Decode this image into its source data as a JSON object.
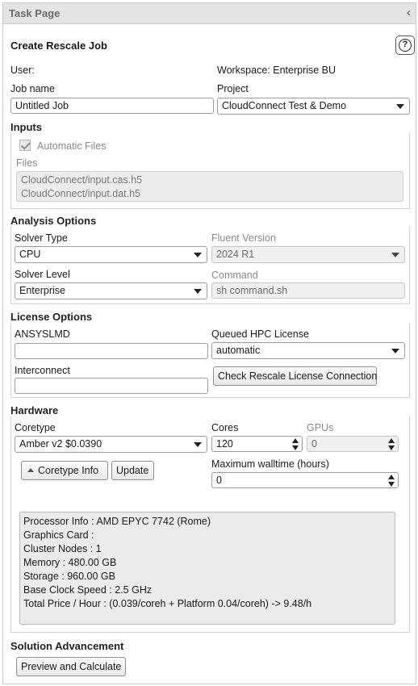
{
  "panel": {
    "title": "Task Page",
    "collapse_glyph": "‹",
    "help_glyph": "?"
  },
  "header": {
    "title": "Create Rescale Job",
    "user_label": "User:",
    "workspace_label": "Workspace: Enterprise BU",
    "job_name_label": "Job name",
    "job_name_value": "Untitled Job",
    "project_label": "Project",
    "project_value": "CloudConnect Test & Demo"
  },
  "inputs": {
    "title": "Inputs",
    "automatic_files_label": "Automatic Files",
    "automatic_files_checked": true,
    "files_label": "Files",
    "files": [
      "CloudConnect/input.cas.h5",
      "CloudConnect/input.dat.h5"
    ]
  },
  "analysis": {
    "title": "Analysis Options",
    "solver_type_label": "Solver Type",
    "solver_type_value": "CPU",
    "fluent_version_label": "Fluent Version",
    "fluent_version_value": "2024 R1",
    "solver_level_label": "Solver Level",
    "solver_level_value": "Enterprise",
    "command_label": "Command",
    "command_value": "sh command.sh"
  },
  "license": {
    "title": "License Options",
    "ansyslmd_label": "ANSYSLMD",
    "ansyslmd_value": "",
    "queued_label": "Queued HPC License",
    "queued_value": "automatic",
    "interconnect_label": "Interconnect",
    "interconnect_value": "",
    "check_button": "Check Rescale License Connection"
  },
  "hardware": {
    "title": "Hardware",
    "coretype_label": "Coretype",
    "coretype_value": "Amber v2 $0.0390",
    "cores_label": "Cores",
    "cores_value": "120",
    "gpus_label": "GPUs",
    "gpus_value": "0",
    "coretype_info_button": "Coretype Info",
    "update_button": "Update",
    "walltime_label": "Maximum walltime (hours)",
    "walltime_value": "0",
    "info_lines": [
      "Processor Info : AMD EPYC 7742 (Rome)",
      "Graphics Card :",
      "Cluster Nodes : 1",
      "Memory : 480.00 GB",
      "Storage : 960.00 GB",
      "Base Clock Speed : 2.5 GHz",
      "Total Price / Hour : (0.039/coreh + Platform 0.04/coreh) -> 9.48/h"
    ]
  },
  "solution": {
    "title": "Solution Advancement",
    "preview_button": "Preview and Calculate"
  }
}
